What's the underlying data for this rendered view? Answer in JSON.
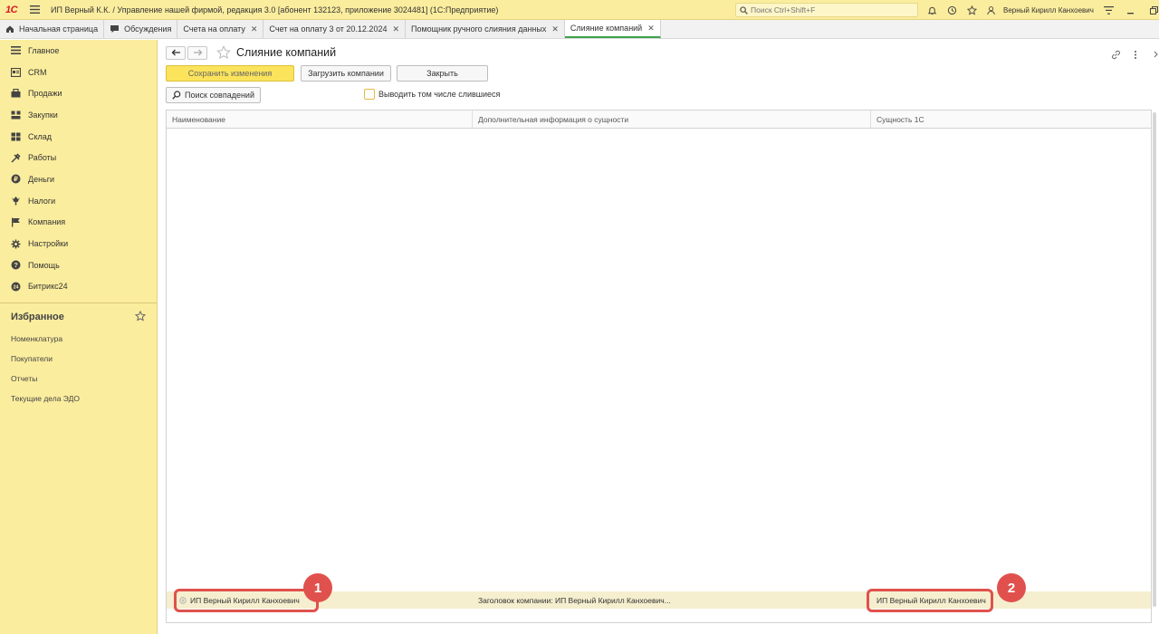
{
  "app": {
    "logo": "1С",
    "title": "ИП Верный К.К. / Управление нашей фирмой, редакция 3.0 [абонент 132123, приложение 3024481]  (1С:Предприятие)",
    "search_placeholder": "Поиск Ctrl+Shift+F",
    "user": "Верный Кирилл Канхоевич"
  },
  "tabs": [
    {
      "label": "Начальная страница",
      "icon": "home-icon",
      "closable": false
    },
    {
      "label": "Обсуждения",
      "icon": "chat-icon",
      "closable": false
    },
    {
      "label": "Счета на оплату",
      "closable": true
    },
    {
      "label": "Счет на оплату 3 от 20.12.2024",
      "closable": true
    },
    {
      "label": "Помощник ручного слияния данных",
      "closable": true
    },
    {
      "label": "Слияние компаний",
      "closable": true,
      "active": true
    }
  ],
  "sidebar": {
    "items": [
      {
        "label": "Главное",
        "icon": "menu-icon"
      },
      {
        "label": "CRM",
        "icon": "crm-icon"
      },
      {
        "label": "Продажи",
        "icon": "sales-icon"
      },
      {
        "label": "Закупки",
        "icon": "purchases-icon"
      },
      {
        "label": "Склад",
        "icon": "warehouse-icon"
      },
      {
        "label": "Работы",
        "icon": "tools-icon"
      },
      {
        "label": "Деньги",
        "icon": "money-icon"
      },
      {
        "label": "Налоги",
        "icon": "taxes-icon"
      },
      {
        "label": "Компания",
        "icon": "flag-icon"
      },
      {
        "label": "Настройки",
        "icon": "gear-icon"
      },
      {
        "label": "Помощь",
        "icon": "help-icon"
      },
      {
        "label": "Битрикс24",
        "icon": "bitrix24-icon"
      }
    ],
    "favorites_title": "Избранное",
    "favorites": [
      "Номенклатура",
      "Покупатели",
      "Отчеты",
      "Текущие дела ЭДО"
    ]
  },
  "form": {
    "title": "Слияние компаний",
    "save_label": "Сохранить изменения",
    "load_label": "Загрузить компании",
    "close_label": "Закрыть",
    "search_matches_label": "Поиск совпадений",
    "show_merged_label": "Выводить том числе слившиеся",
    "show_merged_checked": false
  },
  "table": {
    "columns": [
      "Наименование",
      "Дополнительная информация о сущности",
      "Сущность 1С"
    ],
    "rows": [
      {
        "name": "ИП Верный Кирилл Канхоевич",
        "info": "Заголовок компании: ИП Верный Кирилл Канхоевич...",
        "entity": "ИП Верный Кирилл Канхоевич"
      }
    ]
  },
  "callouts": [
    "1",
    "2"
  ],
  "colors": {
    "accent": "#fbed9e",
    "primary_button": "#fbe35b",
    "callout": "#e0514d",
    "active_tab": "#3fa34d"
  }
}
